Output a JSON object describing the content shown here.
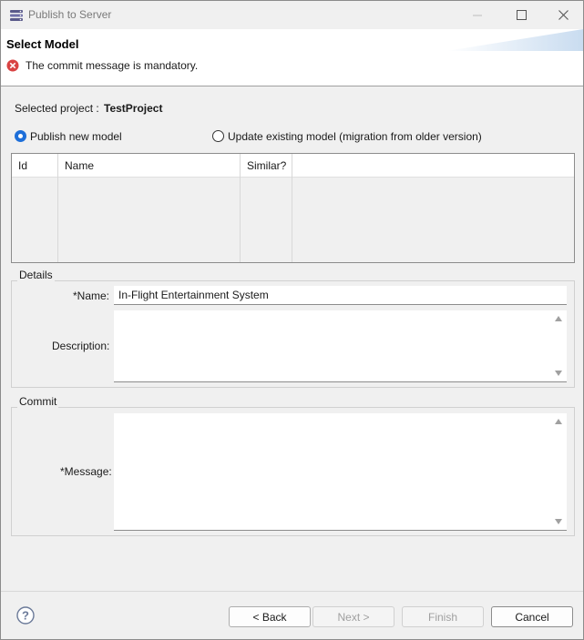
{
  "window": {
    "title": "Publish to Server"
  },
  "banner": {
    "title": "Select Model",
    "error_message": "The commit message is mandatory."
  },
  "project": {
    "label": "Selected project :",
    "value": "TestProject"
  },
  "mode": {
    "publish_new_label": "Publish new model",
    "update_existing_label": "Update existing model (migration from older version)",
    "selected": "publish_new"
  },
  "table": {
    "columns": [
      "Id",
      "Name",
      "Similar?",
      ""
    ],
    "rows": []
  },
  "details": {
    "title": "Details",
    "name_label": "*Name:",
    "name_value": "In-Flight Entertainment System",
    "description_label": "Description:",
    "description_value": ""
  },
  "commit": {
    "title": "Commit",
    "message_label": "*Message:",
    "message_value": ""
  },
  "buttons": {
    "back": "< Back",
    "next": "Next >",
    "finish": "Finish",
    "cancel": "Cancel"
  },
  "colors": {
    "accent": "#1e6fd9",
    "error": "#d94343"
  },
  "icons": {
    "app": "publish-server-icon",
    "error": "error-icon",
    "help": "help-icon"
  }
}
